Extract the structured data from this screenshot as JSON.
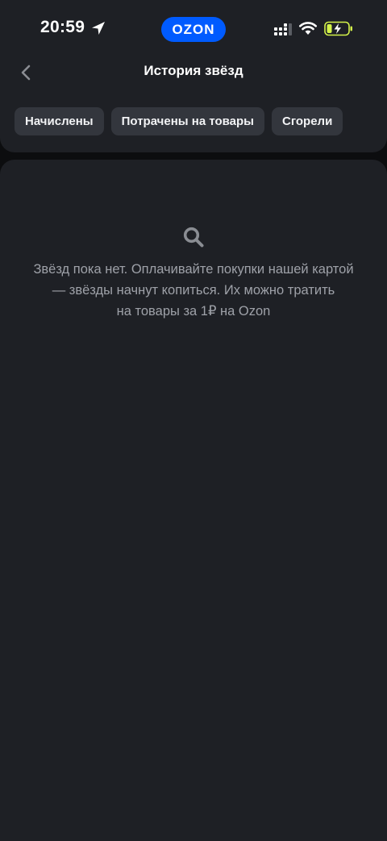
{
  "status_bar": {
    "time": "20:59",
    "location_icon": "location-arrow-icon",
    "signal_icon": "cellular-signal-icon",
    "wifi_icon": "wifi-icon",
    "battery_icon": "battery-charging-icon"
  },
  "brand": {
    "name": "OZON",
    "color": "#005bff"
  },
  "header": {
    "title": "История звёзд",
    "back_icon": "chevron-left-icon"
  },
  "filters": [
    {
      "label": "Начислены"
    },
    {
      "label": "Потрачены на товары"
    },
    {
      "label": "Сгорели"
    }
  ],
  "empty_state": {
    "icon": "search-icon",
    "lines": [
      "Звёзд пока нет. Оплачивайте покупки нашей картой",
      "— звёзды начнут копиться. Их можно тратить",
      "на товары за 1₽ на Ozon"
    ]
  },
  "colors": {
    "background": "#0c0d0f",
    "card": "#1e2025",
    "chip": "#33363d",
    "muted_text": "#9ea1a8",
    "battery_accent": "#d4f34a"
  }
}
